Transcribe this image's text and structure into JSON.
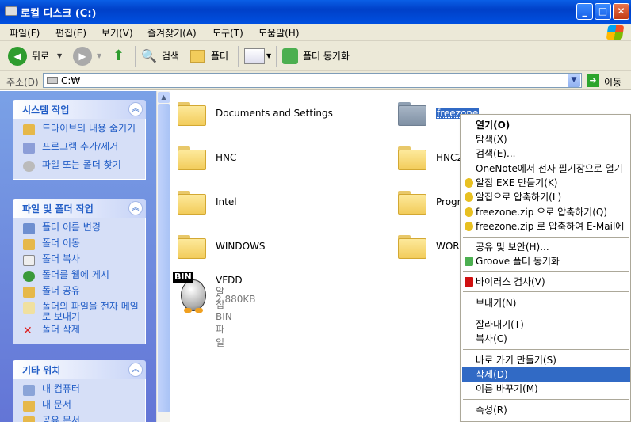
{
  "window": {
    "title": "로컬 디스크 (C:)",
    "minimize": "_",
    "maximize": "□",
    "close": "✕"
  },
  "menu": [
    "파일(F)",
    "편집(E)",
    "보기(V)",
    "즐겨찾기(A)",
    "도구(T)",
    "도움말(H)"
  ],
  "toolbar": {
    "back": "뒤로",
    "search": "검색",
    "folders": "폴더",
    "sync": "폴더 동기화"
  },
  "address": {
    "label": "주소(D)",
    "value": "C:₩",
    "go": "이동"
  },
  "sidebar": {
    "system_tasks": {
      "title": "시스템 작업",
      "items": [
        "드라이브의 내용 숨기기",
        "프로그램 추가/제거",
        "파일 또는 폴더 찾기"
      ]
    },
    "file_tasks": {
      "title": "파일 및 폴더 작업",
      "items": [
        "폴더 이름 변경",
        "폴더 이동",
        "폴더 복사",
        "폴더를 웹에 게시",
        "폴더 공유",
        "폴더의 파일을 전자 메일로 보내기",
        "폴더 삭제"
      ]
    },
    "other_places": {
      "title": "기타 위치",
      "items": [
        "내 컴퓨터",
        "내 문서",
        "공유 문서"
      ]
    }
  },
  "files": [
    {
      "name": "Documents and Settings"
    },
    {
      "name": "freezone"
    },
    {
      "name": "HNC"
    },
    {
      "name": "HNC2"
    },
    {
      "name": "Intel"
    },
    {
      "name": "Progr"
    },
    {
      "name": "WINDOWS"
    },
    {
      "name": "WORK"
    },
    {
      "name": "VFDD",
      "type": "알집 BIN 파일",
      "size": "2,880KB",
      "badge": "BIN"
    }
  ],
  "context_menu": [
    {
      "label": "열기(O)"
    },
    {
      "label": "탐색(X)"
    },
    {
      "label": "검색(E)..."
    },
    {
      "label": "OneNote에서 전자 필기장으로 열기"
    },
    {
      "label": "알집 EXE 만들기(K)"
    },
    {
      "label": "알집으로 압축하기(L)"
    },
    {
      "label": "freezone.zip 으로 압축하기(Q)"
    },
    {
      "label": "freezone.zip 로 압축하여 E-Mail에"
    },
    {
      "label": "공유 및 보안(H)..."
    },
    {
      "label": "Groove 폴더 동기화"
    },
    {
      "label": "바이러스 검사(V)"
    },
    {
      "label": "보내기(N)"
    },
    {
      "label": "잘라내기(T)"
    },
    {
      "label": "복사(C)"
    },
    {
      "label": "바로 가기 만들기(S)"
    },
    {
      "label": "삭제(D)"
    },
    {
      "label": "이름 바꾸기(M)"
    },
    {
      "label": "속성(R)"
    }
  ],
  "colors": {
    "titlebar": "#0a5fe6",
    "selection": "#316ac5",
    "sidebar_link": "#215dc6"
  }
}
